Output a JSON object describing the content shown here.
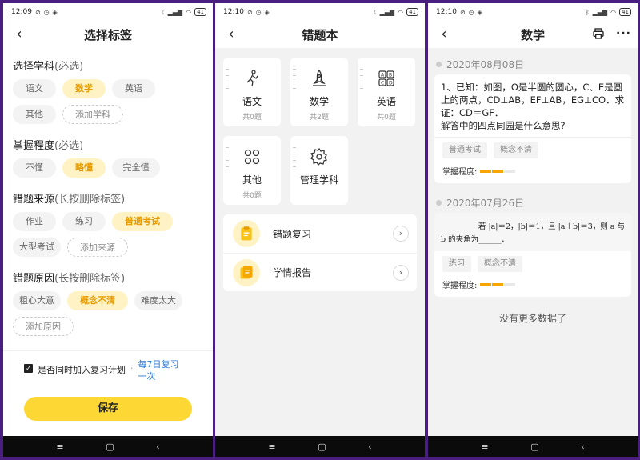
{
  "panel1": {
    "status": {
      "time": "12:09",
      "battery": "41"
    },
    "title": "选择标签",
    "sections": [
      {
        "label": "选择学科",
        "hint": "(必选)"
      },
      {
        "label": "掌握程度",
        "hint": "(必选)"
      },
      {
        "label": "错题来源",
        "hint": "(长按删除标签)"
      },
      {
        "label": "错题原因",
        "hint": "(长按删除标签)"
      }
    ],
    "subject_tags": [
      "语文",
      "数学",
      "英语",
      "其他"
    ],
    "add_subject": "添加学科",
    "mastery_tags": [
      "不懂",
      "略懂",
      "完全懂"
    ],
    "source_tags": [
      "作业",
      "练习",
      "普通考试",
      "大型考试"
    ],
    "add_source": "添加来源",
    "reason_tags": [
      "粗心大意",
      "概念不清",
      "难度太大"
    ],
    "add_reason": "添加原因",
    "plan_label": "是否同时加入复习计划",
    "plan_dot": "·",
    "plan_link": "每7日复习一次",
    "save": "保存"
  },
  "panel2": {
    "status": {
      "time": "12:10",
      "battery": "41"
    },
    "title": "错题本",
    "subjects": [
      {
        "name": "语文",
        "count": "共0题",
        "icon": "dancer-icon"
      },
      {
        "name": "数学",
        "count": "共2题",
        "icon": "rocket-icon"
      },
      {
        "name": "英语",
        "count": "共0题",
        "icon": "abcd-icon"
      },
      {
        "name": "其他",
        "count": "共0题",
        "icon": "circles-icon"
      }
    ],
    "manage": "管理学科",
    "list": [
      {
        "label": "错题复习",
        "icon": "clipboard-icon"
      },
      {
        "label": "学情报告",
        "icon": "report-icon"
      }
    ]
  },
  "panel3": {
    "status": {
      "time": "12:10",
      "battery": "41"
    },
    "title": "数学",
    "entries": [
      {
        "date": "2020年08月08日",
        "text": "1、已知：如图，O是半圆的圆心，C、E是圆上的两点，CD⊥AB，EF⊥AB，EG⊥CO．求证：CD＝GF．",
        "text2": "解答中的四点同园是什么意思?",
        "tags": [
          "普通考试",
          "概念不清"
        ],
        "mastery_label": "掌握程度:",
        "mastery_level": 2
      },
      {
        "date": "2020年07月26日",
        "formula_line1": "若 |a|＝2，|b|＝1，且 |a＋b|＝3，则 a 与",
        "formula_line2": "b 的夹角为______．",
        "tags": [
          "练习",
          "概念不清"
        ],
        "mastery_label": "掌握程度:",
        "mastery_level": 2
      }
    ],
    "no_more": "没有更多数据了"
  },
  "sysbar": {
    "menu": "≡",
    "home": "▢",
    "back": "‹"
  },
  "colors": {
    "accent": "#fdd835",
    "active_text": "#e69a00",
    "link": "#2e7bd8",
    "frame": "#4a1d80"
  }
}
